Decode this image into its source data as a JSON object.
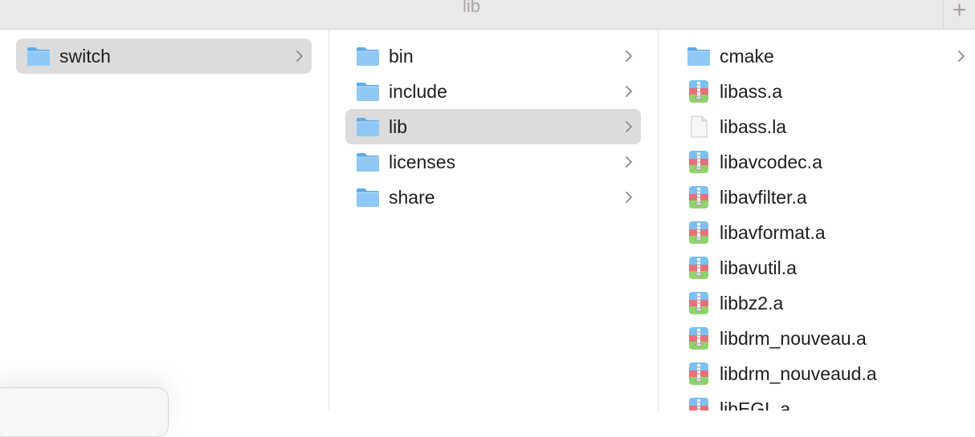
{
  "window": {
    "title": "lib",
    "new_tab_label": "+"
  },
  "columns": [
    {
      "items": [
        {
          "label": "switch",
          "icon": "folder-icon",
          "selected": true,
          "has_children": true
        }
      ]
    },
    {
      "items": [
        {
          "label": "bin",
          "icon": "folder-icon",
          "selected": false,
          "has_children": true
        },
        {
          "label": "include",
          "icon": "folder-icon",
          "selected": false,
          "has_children": true
        },
        {
          "label": "lib",
          "icon": "folder-icon",
          "selected": true,
          "has_children": true
        },
        {
          "label": "licenses",
          "icon": "folder-icon",
          "selected": false,
          "has_children": true
        },
        {
          "label": "share",
          "icon": "folder-icon",
          "selected": false,
          "has_children": true
        }
      ]
    },
    {
      "items": [
        {
          "label": "cmake",
          "icon": "folder-icon",
          "selected": false,
          "has_children": true
        },
        {
          "label": "libass.a",
          "icon": "archive-icon",
          "selected": false,
          "has_children": false
        },
        {
          "label": "libass.la",
          "icon": "document-icon",
          "selected": false,
          "has_children": false
        },
        {
          "label": "libavcodec.a",
          "icon": "archive-icon",
          "selected": false,
          "has_children": false
        },
        {
          "label": "libavfilter.a",
          "icon": "archive-icon",
          "selected": false,
          "has_children": false
        },
        {
          "label": "libavformat.a",
          "icon": "archive-icon",
          "selected": false,
          "has_children": false
        },
        {
          "label": "libavutil.a",
          "icon": "archive-icon",
          "selected": false,
          "has_children": false
        },
        {
          "label": "libbz2.a",
          "icon": "archive-icon",
          "selected": false,
          "has_children": false
        },
        {
          "label": "libdrm_nouveau.a",
          "icon": "archive-icon",
          "selected": false,
          "has_children": false
        },
        {
          "label": "libdrm_nouveaud.a",
          "icon": "archive-icon",
          "selected": false,
          "has_children": false
        },
        {
          "label": "libEGL.a",
          "icon": "archive-icon",
          "selected": false,
          "has_children": false
        }
      ]
    }
  ],
  "colors": {
    "selection": "#dcdcdc",
    "folder_light": "#8fc8f5",
    "folder_dark": "#5ea9e6",
    "archive_blue": "#7cc0f0",
    "archive_red": "#e8707a",
    "archive_green": "#8ed36b"
  }
}
